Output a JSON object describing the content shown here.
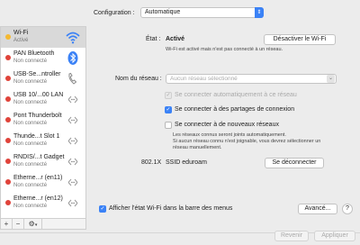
{
  "config": {
    "label": "Configuration :",
    "value": "Automatique"
  },
  "services": [
    {
      "name": "Wi-Fi",
      "status": "Activé",
      "color": "#f5b931",
      "icon": "wifi-icon",
      "selected": true
    },
    {
      "name": "PAN Bluetooth",
      "status": "Non connecté",
      "color": "#e0433a",
      "icon": "bluetooth-icon"
    },
    {
      "name": "USB-Se...ntroller",
      "status": "Non connecté",
      "color": "#e0433a",
      "icon": "phone-icon"
    },
    {
      "name": "USB 10/...00 LAN",
      "status": "Non connecté",
      "color": "#e0433a",
      "icon": "ethernet-icon"
    },
    {
      "name": "Pont Thunderbolt",
      "status": "Non connecté",
      "color": "#e0433a",
      "icon": "ethernet-icon"
    },
    {
      "name": "Thunde...t Slot  1",
      "status": "Non connecté",
      "color": "#e0433a",
      "icon": "ethernet-icon"
    },
    {
      "name": "RNDIS/...t Gadget",
      "status": "Non connecté",
      "color": "#e0433a",
      "icon": "ethernet-icon"
    },
    {
      "name": "Etherne...r (en11)",
      "status": "Non connecté",
      "color": "#e0433a",
      "icon": "ethernet-icon"
    },
    {
      "name": "Etherne...r (en12)",
      "status": "Non connecté",
      "color": "#e0433a",
      "icon": "ethernet-icon"
    }
  ],
  "sidebar_tools": {
    "add": "+",
    "remove": "−",
    "gear": "⚙",
    "chevron": "▾"
  },
  "status": {
    "label": "État :",
    "value": "Activé",
    "button": "Désactiver le Wi-Fi",
    "description": "Wi-Fi est activé mais n'est pas connecté à un réseau."
  },
  "network": {
    "label": "Nom du réseau :",
    "placeholder": "Aucun réseau sélectionné"
  },
  "options": {
    "auto_connect": {
      "label": "Se connecter automatiquement à ce réseau",
      "checked": true,
      "disabled": true
    },
    "hotspots": {
      "label": "Se connecter à des partages de connexion",
      "checked": true
    },
    "new_networks": {
      "label": "Se connecter à de nouveaux réseaux",
      "checked": false
    },
    "note_line1": "Les réseaux connus seront joints automatiquement.",
    "note_line2": "Si aucun réseau connu n'est joignable, vous devrez sélectionner un",
    "note_line3": "réseau manuellement."
  },
  "ssid": {
    "label": "802.1X",
    "value": "SSID eduroam",
    "button": "Se déconnecter"
  },
  "menubar_option": {
    "label": "Afficher l'état Wi-Fi dans la barre des menus",
    "checked": true
  },
  "advanced_button": "Avancé...",
  "help_button": "?",
  "footer": {
    "revert": "Revenir",
    "apply": "Appliquer"
  },
  "colors": {
    "accent": "#3b82f6",
    "inactive": "#e0433a",
    "active": "#f5b931"
  }
}
